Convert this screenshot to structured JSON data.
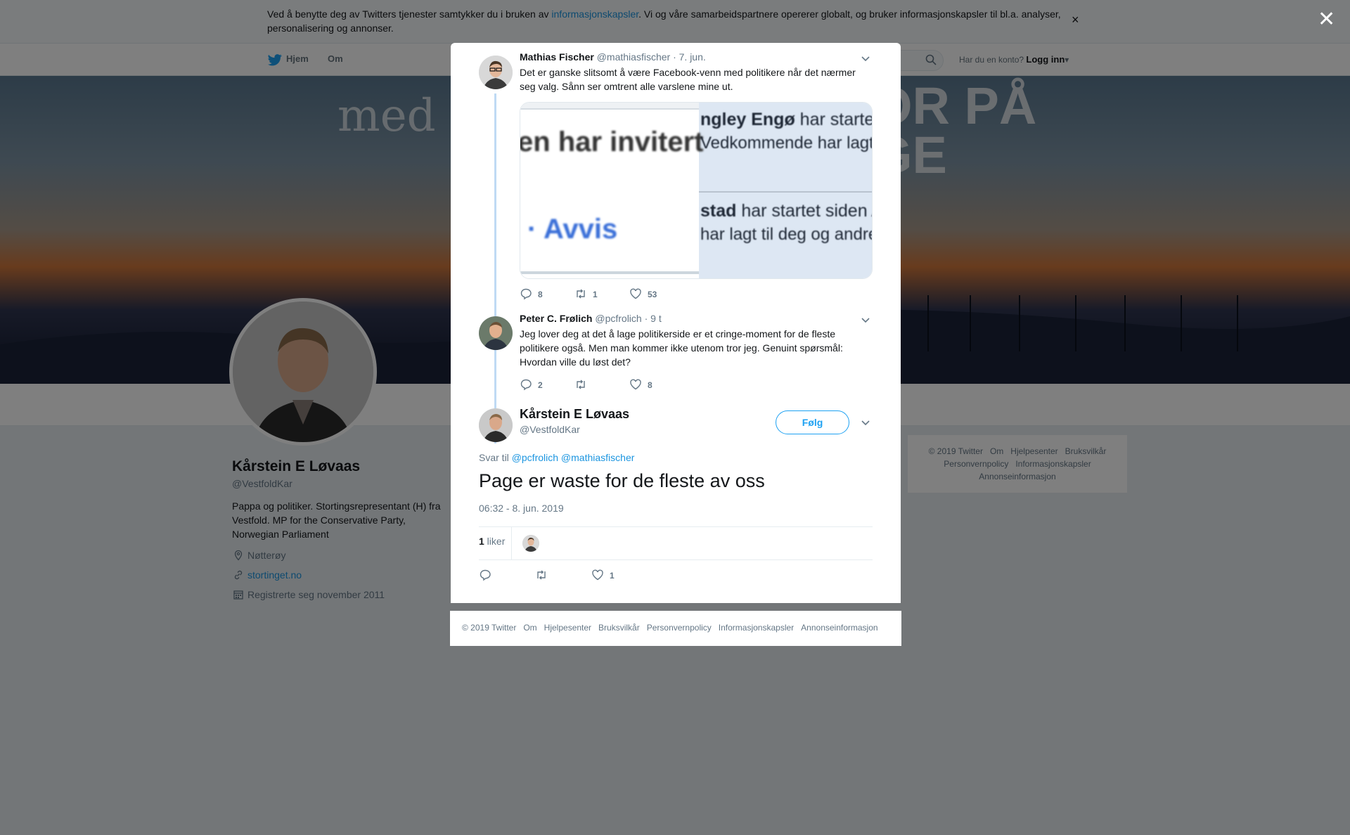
{
  "cookie_banner": {
    "text_before": "Ved å benytte deg av Twitters tjenester samtykker du i bruken av ",
    "link": "informasjonskapsler",
    "text_after": ". Vi og våre samarbeidspartnere opererer globalt, og bruker informasjonskapsler til bl.a. analyser, personalisering og annonser.",
    "close": "×"
  },
  "nav": {
    "home": "Hjem",
    "about": "Om",
    "account_prompt": "Har du en konto?",
    "login": "Logg inn",
    "caret": "▾"
  },
  "banner": {
    "line1": "med",
    "right1": "OR PÅ",
    "right2": "GE"
  },
  "profile": {
    "name": "Kårstein E Løvaas",
    "handle": "@VestfoldKar",
    "bio": "Pappa og politiker. Stortingsrepresentant (H) fra Vestfold. MP for the Conservative Party, Norwegian Parliament",
    "location": "Nøtterøy",
    "website": "stortinget.no",
    "joined": "Registrerte seg november 2011"
  },
  "side_footer": {
    "items": [
      "© 2019 Twitter",
      "Om",
      "Hjelpesenter",
      "Bruksvilkår",
      "Personvernpolicy",
      "Informasjonskapsler",
      "Annonseinformasjon"
    ]
  },
  "overlay": {
    "close": "✕"
  },
  "thread": [
    {
      "name": "Mathias Fischer",
      "handle": "@mathiasfischer",
      "time": "· 7. jun.",
      "text": "Det er ganske slitsomt å være Facebook-venn med politikere når det nærmer seg valg. Sånn ser omtrent alle varslene mine ut.",
      "media": {
        "t1": "en har invitert",
        "t2": "· Avvis",
        "t3_bold": "ngley Engø",
        "t3": " har startet",
        "t4": "Vedkommende har lagt",
        "t5_bold": "stad",
        "t5": " har startet siden A",
        "t6": "har lagt til deg og andre"
      },
      "replies": "8",
      "retweets": "1",
      "likes": "53"
    },
    {
      "name": "Peter C. Frølich",
      "handle": "@pcfrolich",
      "time": "· 9 t",
      "text": "Jeg lover deg at det å lage politikerside er et cringe-moment for de fleste politikere også. Men man kommer ikke utenom tror jeg. Genuint spørsmål: Hvordan ville du løst det?",
      "replies": "2",
      "retweets": "",
      "likes": "8"
    }
  ],
  "main_tweet": {
    "name": "Kårstein E Løvaas",
    "handle": "@VestfoldKar",
    "follow": "Følg",
    "reply_prefix": "Svar til",
    "reply_mentions": "@pcfrolich @mathiasfischer",
    "text": "Page er waste for de fleste av oss",
    "timestamp": "06:32 - 8. jun. 2019",
    "likes_number": "1",
    "likes_word": " liker",
    "action_likes": "1"
  },
  "modal_footer": {
    "items": [
      "© 2019 Twitter",
      "Om",
      "Hjelpesenter",
      "Bruksvilkår",
      "Personvernpolicy",
      "Informasjonskapsler",
      "Annonseinformasjon"
    ]
  },
  "colors": {
    "twitter_blue": "#1da1f2",
    "link_blue": "#1b95e0",
    "thread_line": "#bfdaf4",
    "muted": "#657786"
  }
}
